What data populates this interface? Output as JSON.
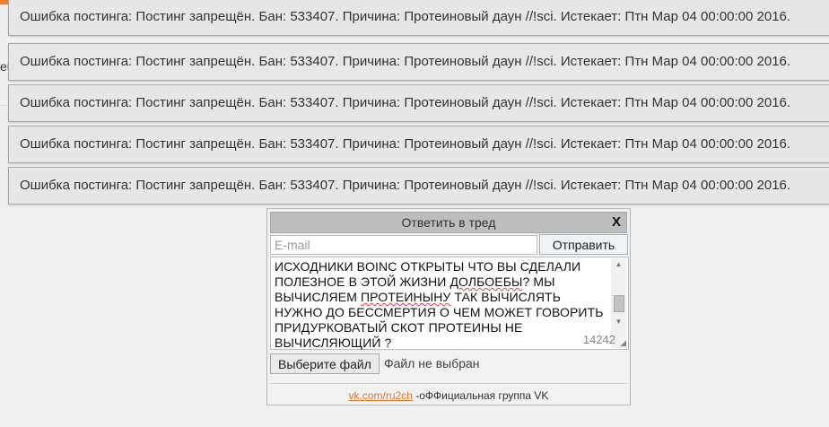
{
  "background": {
    "peek_text": "eu"
  },
  "toasts": [
    {
      "text": "Ошибка постинга: Постинг запрещён. Бан: 533407. Причина: Протеиновый даун //!sci. Истекает: Птн Мар 04 00:00:00 2016."
    },
    {
      "text": "Ошибка постинга: Постинг запрещён. Бан: 533407. Причина: Протеиновый даун //!sci. Истекает: Птн Мар 04 00:00:00 2016."
    },
    {
      "text": "Ошибка постинга: Постинг запрещён. Бан: 533407. Причина: Протеиновый даун //!sci. Истекает: Птн Мар 04 00:00:00 2016."
    },
    {
      "text": "Ошибка постинга: Постинг запрещён. Бан: 533407. Причина: Протеиновый даун //!sci. Истекает: Птн Мар 04 00:00:00 2016."
    },
    {
      "text": "Ошибка постинга: Постинг запрещён. Бан: 533407. Причина: Протеиновый даун //!sci. Истекает: Птн Мар 04 00:00:00 2016."
    }
  ],
  "reply": {
    "title": "Ответить в тред",
    "close_label": "X",
    "email_placeholder": "E-mail",
    "email_value": "",
    "send_label": "Отправить",
    "message_parts": [
      "ИСХОДНИКИ BOINC ОТКРЫТЫ ЧТО ВЫ СДЕЛАЛИ ПОЛЕЗНОЕ В ЭТОЙ ЖИЗНИ ",
      "ДОЛБОЕБЫ",
      "? МЫ ВЫЧИСЛЯЕМ ",
      "ПРОТЕИНЫНУ",
      " ТАК ВЫЧИСЛЯТЬ НУЖНО ДО БЕССМЕРТИЯ О ЧЕМ МОЖЕТ ГОВОРИТЬ ПРИДУРКОВАТЫЙ СКОТ ПРОТЕИНЫ НЕ ВЫЧИСЛЯЮЩИЙ ?"
    ],
    "char_count": "14242",
    "file_button_label": "Выберите файл",
    "file_status": "Файл не выбран",
    "footer_link": "vk.com/ru2ch",
    "footer_text": " -оФФициальная группа VK"
  },
  "colors": {
    "accent": "#ee7e2f",
    "link": "#e8762a"
  }
}
